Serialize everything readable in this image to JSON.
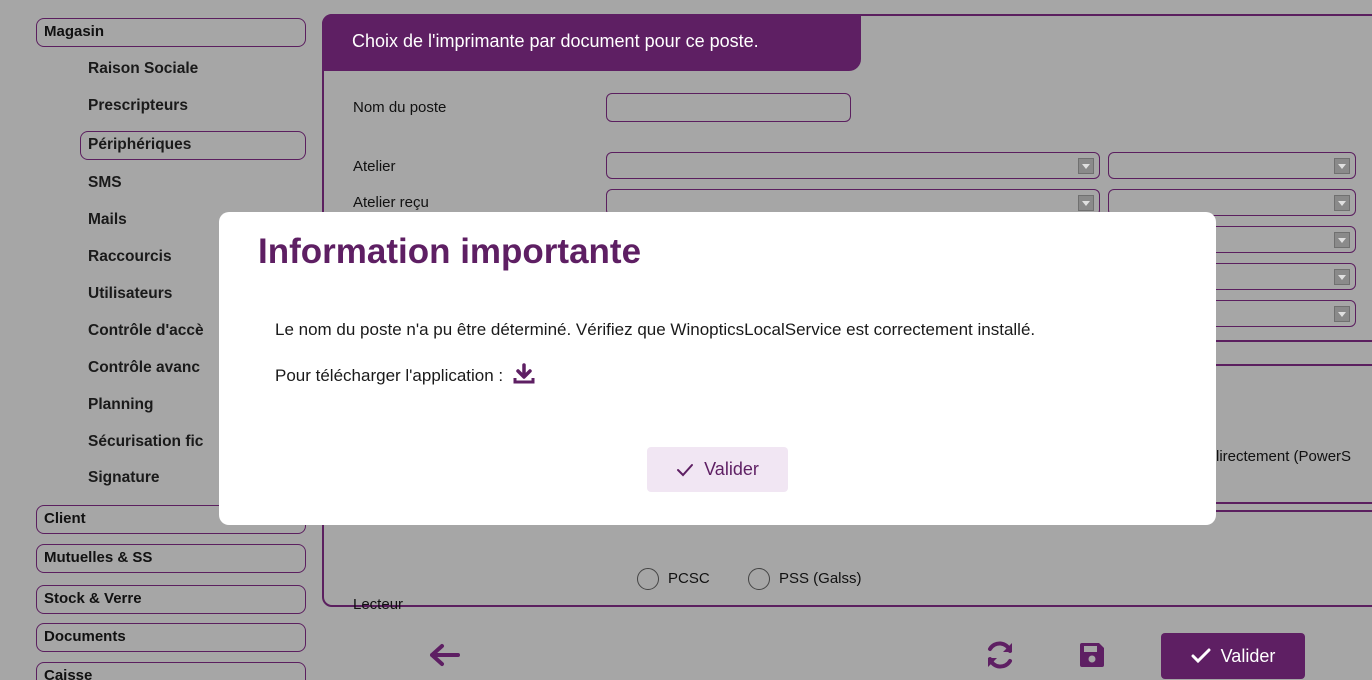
{
  "sidebar": {
    "magasin": "Magasin",
    "items": [
      "Raison Sociale",
      "Prescripteurs",
      "Périphériques",
      "SMS",
      "Mails",
      "Raccourcis",
      "Utilisateurs",
      "Contrôle d'accè",
      "Contrôle avanc",
      "Planning",
      "Sécurisation fic",
      "Signature"
    ],
    "client": "Client",
    "mutuelles": "Mutuelles & SS",
    "stock": "Stock & Verre",
    "documents": "Documents",
    "caisse": "Caisse"
  },
  "panel": {
    "title": "Choix de l'imprimante par document pour ce poste.",
    "nom_poste_label": "Nom du poste",
    "nom_poste_value": "",
    "atelier_label": "Atelier",
    "atelier_recu_label": "Atelier reçu"
  },
  "panel2": {
    "partial_text": "lirectement (PowerS"
  },
  "panel3": {
    "lecteur_label": "Lecteur",
    "options": [
      "PCSC",
      "PSS (Galss)"
    ]
  },
  "bottom": {
    "valider_label": "Valider"
  },
  "modal": {
    "title": "Information importante",
    "message": "Le nom du poste n'a pu être déterminé. Vérifiez que WinopticsLocalService est correctement installé.",
    "download_text": "Pour télécharger l'application :",
    "button_label": "Valider"
  },
  "colors": {
    "accent": "#5e1f63",
    "overlay": "#a6a6a6",
    "button_light": "#f1e6f3"
  }
}
